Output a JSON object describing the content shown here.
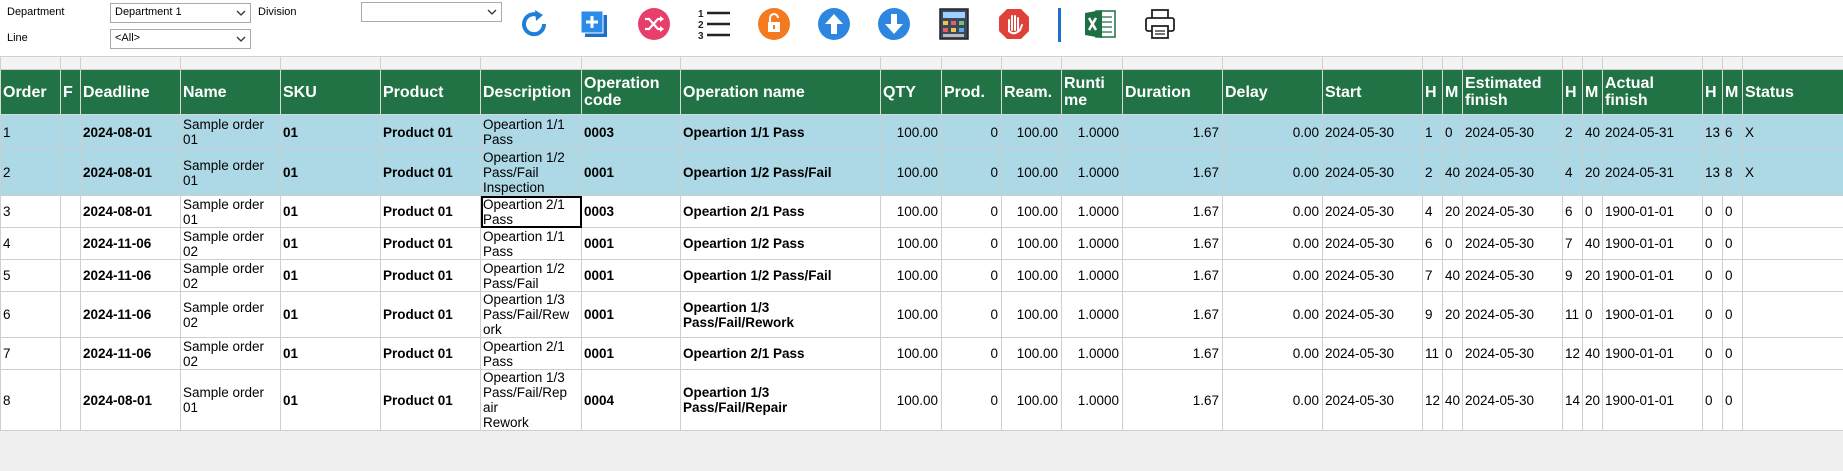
{
  "filters": {
    "department_label": "Department",
    "department_value": "Department 1",
    "line_label": "Line",
    "line_value": "<All>",
    "division_label": "Division",
    "division_value": ""
  },
  "toolbar": {
    "icons": [
      "refresh-icon",
      "add-copy-icon",
      "shuffle-icon",
      "numbered-list-icon",
      "unlock-icon",
      "arrow-up-icon",
      "arrow-down-icon",
      "calculator-icon",
      "stop-hand-icon",
      "excel-icon",
      "print-icon"
    ]
  },
  "colors": {
    "header_bg": "#217346",
    "selected_row": "#add8e6"
  },
  "table": {
    "headers": [
      "Order",
      "F",
      "Deadline",
      "Name",
      "SKU",
      "Product",
      "Description",
      "Operation code",
      "Operation name",
      "QTY",
      "Prod.",
      "Ream.",
      "Runtime",
      "Duration",
      "Delay",
      "Start",
      "H",
      "M",
      "Estimated finish",
      "H",
      "M",
      "Actual finish",
      "H",
      "M",
      "Status"
    ],
    "header_display": [
      "Order",
      "F",
      "Deadline",
      "Name",
      "SKU",
      "Product",
      "Description",
      "Operation\ncode",
      "Operation name",
      "QTY",
      "Prod.",
      "Ream.",
      "Runti\nme",
      "Duration",
      "Delay",
      "Start",
      "H",
      "M",
      "Estimated\nfinish",
      "H",
      "M",
      "Actual\nfinish",
      "H",
      "M",
      "Status"
    ],
    "rows": [
      {
        "cells": [
          "1",
          "",
          "2024-08-01",
          "Sample order\n01",
          "01",
          "Product 01",
          "Opeartion 1/1\nPass",
          "0003",
          "Opeartion 1/1 Pass",
          "100.00",
          "0",
          "100.00",
          "1.0000",
          "1.67",
          "0.00",
          "2024-05-30",
          "1",
          "0",
          "2024-05-30",
          "2",
          "40",
          "2024-05-31",
          "13",
          "6",
          "X"
        ]
      },
      {
        "cells": [
          "2",
          "",
          "2024-08-01",
          "Sample order\n01",
          "01",
          "Product 01",
          "Opeartion 1/2\nPass/Fail\nInspection",
          "0001",
          "Opeartion 1/2 Pass/Fail",
          "100.00",
          "0",
          "100.00",
          "1.0000",
          "1.67",
          "0.00",
          "2024-05-30",
          "2",
          "40",
          "2024-05-30",
          "4",
          "20",
          "2024-05-31",
          "13",
          "8",
          "X"
        ]
      },
      {
        "cells": [
          "3",
          "",
          "2024-08-01",
          "Sample order\n01",
          "01",
          "Product 01",
          "Opeartion 2/1\nPass",
          "0003",
          "Opeartion 2/1 Pass",
          "100.00",
          "0",
          "100.00",
          "1.0000",
          "1.67",
          "0.00",
          "2024-05-30",
          "4",
          "20",
          "2024-05-30",
          "6",
          "0",
          "1900-01-01",
          "0",
          "0",
          ""
        ]
      },
      {
        "cells": [
          "4",
          "",
          "2024-11-06",
          "Sample order\n02",
          "01",
          "Product 01",
          "Opeartion 1/1\nPass",
          "0001",
          "Opeartion 1/2 Pass",
          "100.00",
          "0",
          "100.00",
          "1.0000",
          "1.67",
          "0.00",
          "2024-05-30",
          "6",
          "0",
          "2024-05-30",
          "7",
          "40",
          "1900-01-01",
          "0",
          "0",
          ""
        ]
      },
      {
        "cells": [
          "5",
          "",
          "2024-11-06",
          "Sample order\n02",
          "01",
          "Product 01",
          "Opeartion 1/2\nPass/Fail",
          "0001",
          "Opeartion 1/2 Pass/Fail",
          "100.00",
          "0",
          "100.00",
          "1.0000",
          "1.67",
          "0.00",
          "2024-05-30",
          "7",
          "40",
          "2024-05-30",
          "9",
          "20",
          "1900-01-01",
          "0",
          "0",
          ""
        ]
      },
      {
        "cells": [
          "6",
          "",
          "2024-11-06",
          "Sample order\n02",
          "01",
          "Product 01",
          "Opeartion 1/3\nPass/Fail/Rew\nork",
          "0001",
          "Opeartion 1/3\nPass/Fail/Rework",
          "100.00",
          "0",
          "100.00",
          "1.0000",
          "1.67",
          "0.00",
          "2024-05-30",
          "9",
          "20",
          "2024-05-30",
          "11",
          "0",
          "1900-01-01",
          "0",
          "0",
          ""
        ]
      },
      {
        "cells": [
          "7",
          "",
          "2024-11-06",
          "Sample order\n02",
          "01",
          "Product 01",
          "Opeartion 2/1\nPass",
          "0001",
          "Opeartion 2/1 Pass",
          "100.00",
          "0",
          "100.00",
          "1.0000",
          "1.67",
          "0.00",
          "2024-05-30",
          "11",
          "0",
          "2024-05-30",
          "12",
          "40",
          "1900-01-01",
          "0",
          "0",
          ""
        ]
      },
      {
        "cells": [
          "8",
          "",
          "2024-08-01",
          "Sample order\n01",
          "01",
          "Product 01",
          "Opeartion 1/3\nPass/Fail/Rep\nair\nRework",
          "0004",
          "Opeartion 1/3\nPass/Fail/Repair",
          "100.00",
          "0",
          "100.00",
          "1.0000",
          "1.67",
          "0.00",
          "2024-05-30",
          "12",
          "40",
          "2024-05-30",
          "14",
          "20",
          "1900-01-01",
          "0",
          "0",
          ""
        ]
      }
    ]
  }
}
